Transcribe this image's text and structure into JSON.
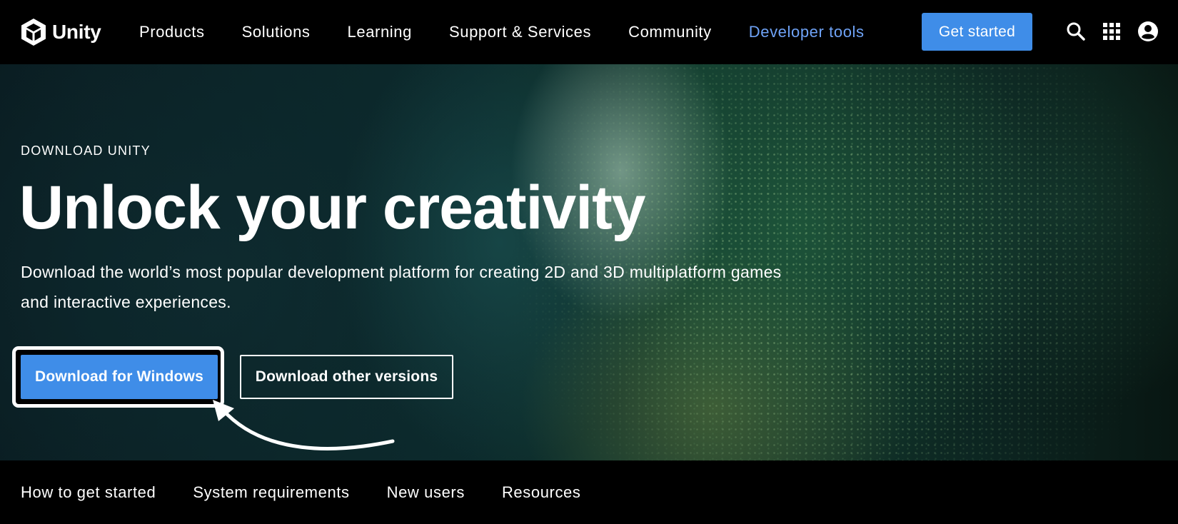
{
  "nav": {
    "logo_text": "Unity",
    "links": [
      "Products",
      "Solutions",
      "Learning",
      "Support & Services",
      "Community",
      "Developer tools"
    ],
    "cta_label": "Get started",
    "icons": [
      "search-icon",
      "apps-grid-icon",
      "account-icon"
    ],
    "accent_color": "#3f8de8",
    "active_link_color": "#6fa3f7"
  },
  "hero": {
    "eyebrow": "DOWNLOAD UNITY",
    "headline": "Unlock your creativity",
    "subtitle": "Download the world’s most popular development platform for creating 2D and 3D multiplatform games and interactive experiences.",
    "primary_button": "Download for Windows",
    "secondary_button": "Download other versions"
  },
  "subnav": {
    "items": [
      "How to get started",
      "System requirements",
      "New users",
      "Resources"
    ]
  }
}
